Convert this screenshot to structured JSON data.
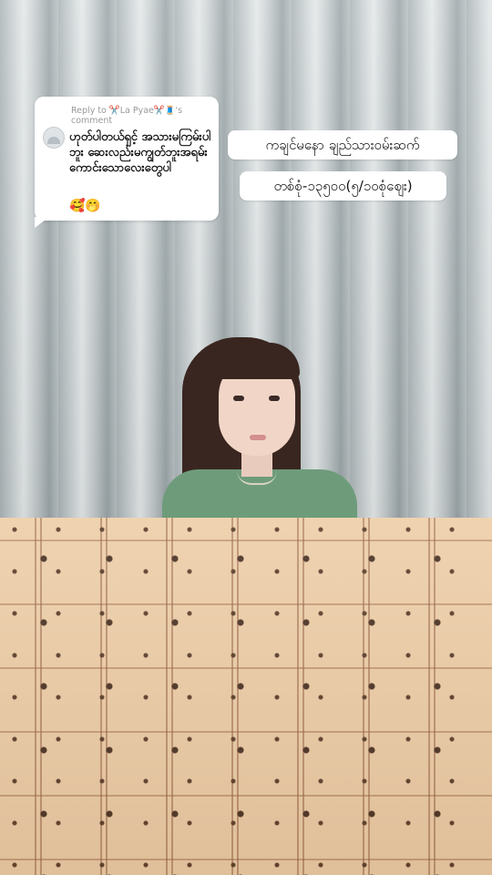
{
  "reply_bubble": {
    "reply_prefix": "Reply to",
    "username": "✂️La Pyae✂️🧵's",
    "reply_suffix": "comment",
    "comment_text": "ဟုတ်ပါတယ်ရှင့် အသားမကြမ်းပါဘူး ဆေးလည်းမကျွတ်ဘူးအရမ်းကောင်းသောလေးတွေပါ",
    "emojis": "🥰🤭"
  },
  "captions": {
    "line1": "ကချင်မနော ချည်သားဝမ်းဆက်",
    "line2": "တစ်စုံ-၁၃၅၀၀(၅/၁၀စုံဈေး)"
  },
  "colors": {
    "curtain": "#c9d0d2",
    "fabric": "#eecfaa",
    "pattern": "#4a3326",
    "bubble": "#ffffff"
  }
}
